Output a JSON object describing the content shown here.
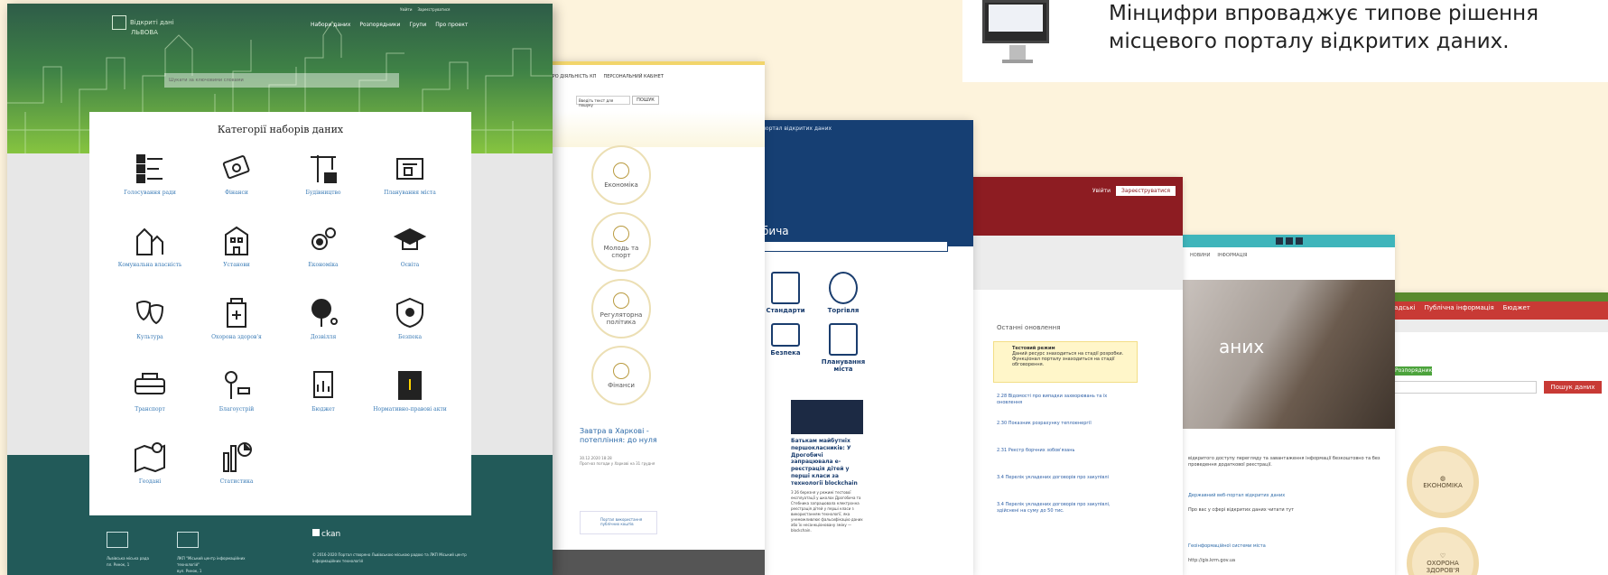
{
  "headline": {
    "title": "Мінцифри впроваджує типове рішення\nмісцевого порталу відкритих даних."
  },
  "lviv": {
    "logo_line1": "Відкриті дані",
    "logo_line2": "ЛЬВОВА",
    "auth": [
      "Увійти",
      "Зареєструватися"
    ],
    "nav": [
      "Набори даних",
      "Розпорядники",
      "Групи",
      "Про проект"
    ],
    "search_placeholder": "Шукати за ключовими словами",
    "panel_title": "Категорії наборів даних",
    "categories": [
      "Голосування ради",
      "Фінанси",
      "Будівництво",
      "Планування міста",
      "Комунальна власність",
      "Установи",
      "Економіка",
      "Освіта",
      "Культура",
      "Охорона здоров'я",
      "Дозвілля",
      "Безпека",
      "Транспорт",
      "Благоустрій",
      "Бюджет",
      "Нормативно-правові акти",
      "Геодані",
      "Статистика"
    ],
    "footer": {
      "org1": "Львівська міська рада",
      "org1_addr": "пл. Ринок, 1",
      "org2": "ЛКП \"Міський центр інформаційних технологій\"",
      "org2_addr": "вул. Ринок, 1",
      "ckan": "ckan",
      "copyright": "© 2016-2020 Портал створено Львівською міською радою та ЛКП Міський центр інформаційних технологій"
    }
  },
  "portal1": {
    "menu": [
      "ПРО ДІЯЛЬНІСТЬ КП",
      "ПЕРСОНАЛЬНИЙ КАБІНЕТ"
    ],
    "search_placeholder": "Введіть текст для пошуку",
    "search_button": "ПОШУК",
    "circles": [
      "Економіка",
      "Молодь та спорт",
      "Регуляторна політика",
      "Фінанси"
    ],
    "news_title": "Завтра в Харкові - потепління: до нуля",
    "news_date": "30.12.2020 18:28",
    "news_snippet": "Прогноз погоди у Харкові на 31 грудня",
    "footer_box": "Портал використання публічних коштів"
  },
  "portal2": {
    "title_small": "портал відкритих даних",
    "title_big": "бича",
    "cats": [
      "Стандарти",
      "Торгівля",
      "Безпека",
      "Планування міста"
    ],
    "news_title": "Батькам майбутніх першокласників: У Дрогобичі запрацювала е-реєстрація дітей у перші класи за технології blockchain",
    "news_snippet": "З 26 березня у режимі тестової експлуатації у школах Дрогобича та Стебника запрацювала електронна реєстрація дітей у перші класи з використанням технології, яка унеможливлює фальсифікацію даних або їх несанкціоновану зміну — blockchain."
  },
  "portal3": {
    "login": "Увійти",
    "register": "Зареєструватися",
    "section": "Останні оновлення",
    "warn_title": "Тестовий режим",
    "warn_text": "Даний ресурс знаходиться на стадії розробки. Функціонал порталу знаходиться на стадії обговорення.",
    "items": [
      "2.28 Відомості про випадки захворювань та їх оновлення",
      "2.30 Показник розрахунку теплоенергії",
      "2.31 Реєстр борчних зобов'язань",
      "3.4 Перелік укладених договорів про закупівлі",
      "3.4 Перелік укладених договорів про закупівлі, здійснені на суму до 50 тис."
    ]
  },
  "portal4": {
    "menu": [
      "НОВИНИ",
      "ІНФОРМАЦІЯ"
    ],
    "hero_text": "аних",
    "p1": "відкритого доступу перегляду та завантаження інформації безкоштовно та без проведення додаткової реєстрації.",
    "link1": "Державний веб-портал відкритих даних",
    "p2": "Про вас у сфері відкритих даних читати тут",
    "link2": "Геоінформаційної системи міста",
    "p3": "http://gis.krm.gov.ua"
  },
  "portal5": {
    "menu": [
      "Громадські",
      "Публічна інформація",
      "Бюджет"
    ],
    "tag": "Розпорядники",
    "button": "Пошук даних",
    "circles": [
      "ЕКОНОМІКА",
      "ОХОРОНА ЗДОРОВ'Я"
    ]
  }
}
